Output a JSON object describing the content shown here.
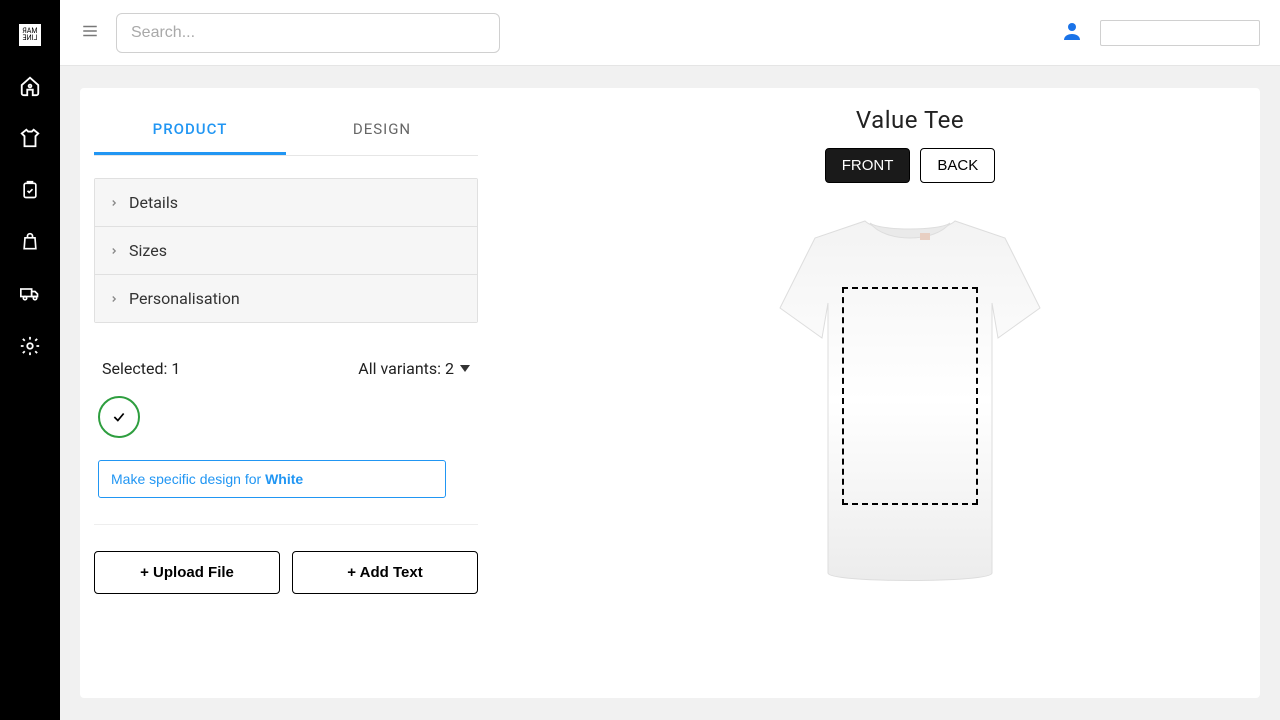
{
  "search": {
    "placeholder": "Search..."
  },
  "tabs": {
    "product": "PRODUCT",
    "design": "DESIGN"
  },
  "accordion": {
    "details": "Details",
    "sizes": "Sizes",
    "personalisation": "Personalisation"
  },
  "variants": {
    "selected_label": "Selected: 1",
    "all_label": "All variants: 2",
    "specific_prefix": "Make specific design for ",
    "specific_color": "White"
  },
  "actions": {
    "upload": "+ Upload File",
    "add_text": "+ Add Text"
  },
  "product": {
    "title": "Value Tee",
    "front": "FRONT",
    "back": "BACK"
  }
}
